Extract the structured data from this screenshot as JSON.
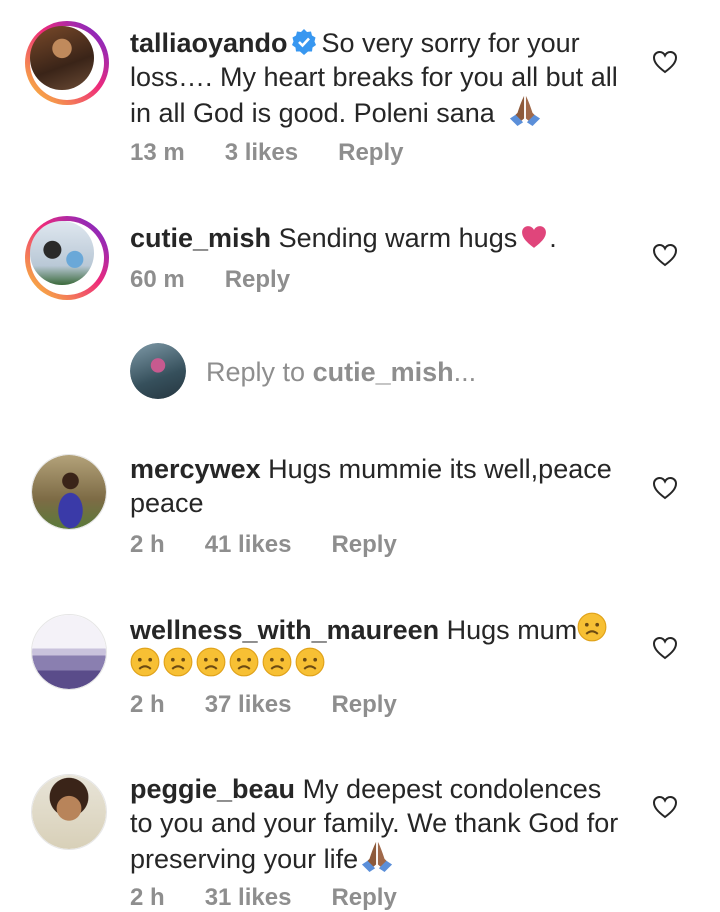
{
  "comments": [
    {
      "username": "talliaoyando",
      "verified": true,
      "text": "So very sorry for your loss…. My heart breaks for you all but all in all God is good. Poleni sana",
      "time": "13 m",
      "likes": "3 likes",
      "reply": "Reply"
    },
    {
      "username": "cutie_mish",
      "text": "Sending warm hugs",
      "text_after": ".",
      "time": "60 m",
      "reply": "Reply"
    },
    {
      "username": "mercywex",
      "text": "Hugs mummie its well,peace peace",
      "time": "2 h",
      "likes": "41 likes",
      "reply": "Reply"
    },
    {
      "username": "wellness_with_maureen",
      "text": "Hugs mum",
      "time": "2 h",
      "likes": "37 likes",
      "reply": "Reply"
    },
    {
      "username": "peggie_beau",
      "text": "My deepest condolences to you and your family. We thank God for preserving your life",
      "time": "2 h",
      "likes": "31 likes",
      "reply": "Reply"
    }
  ],
  "reply_box": {
    "prefix": "Reply to ",
    "target": "cutie_mish",
    "suffix": "..."
  },
  "colors": {
    "text": "#262626",
    "meta": "#8e8e8e",
    "verified": "#3897f0",
    "heart_emoji": "#e0457b"
  },
  "icons": [
    "verified-badge-icon",
    "like-heart-icon",
    "praying-hands-emoji",
    "red-heart-emoji",
    "sad-face-emoji"
  ]
}
